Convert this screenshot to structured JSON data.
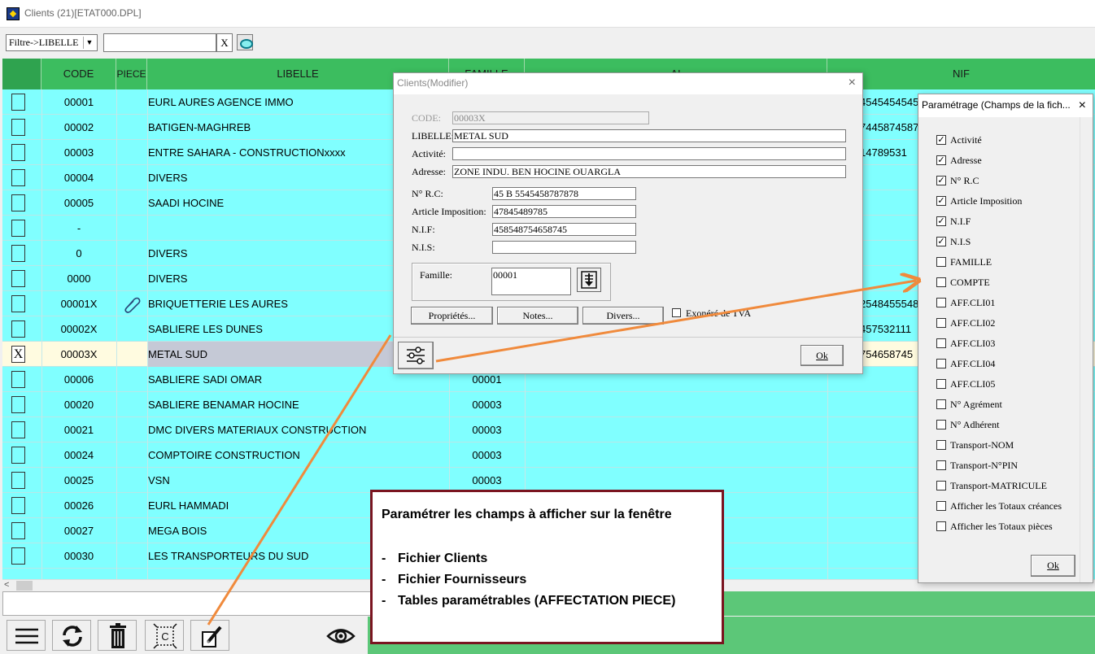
{
  "window": {
    "title": "Clients (21)[ETAT000.DPL]"
  },
  "filter": {
    "selected": "Filtre->LIBELLE",
    "value": "",
    "clear_label": "X"
  },
  "grid": {
    "columns": [
      "CODE",
      "PIECE",
      "LIBELLE",
      "FAMILLE",
      "AI",
      "NIF"
    ],
    "rows": [
      {
        "check": "",
        "code": "00001",
        "piece": "",
        "libelle": "EURL AURES AGENCE IMMO",
        "famille": "",
        "ai": "",
        "nif": "4545454545"
      },
      {
        "check": "",
        "code": "00002",
        "piece": "",
        "libelle": "BATIGEN-MAGHREB",
        "famille": "",
        "ai": "",
        "nif": "7445874587"
      },
      {
        "check": "",
        "code": "00003",
        "piece": "",
        "libelle": "ENTRE SAHARA - CONSTRUCTIONxxxx",
        "famille": "",
        "ai": "",
        "nif": "14789531"
      },
      {
        "check": "",
        "code": "00004",
        "piece": "",
        "libelle": "DIVERS",
        "famille": "",
        "ai": "",
        "nif": ""
      },
      {
        "check": "",
        "code": "00005",
        "piece": "",
        "libelle": "SAADI HOCINE",
        "famille": "",
        "ai": "",
        "nif": ""
      },
      {
        "check": "",
        "code": "-",
        "piece": "",
        "libelle": "",
        "famille": "",
        "ai": "",
        "nif": ""
      },
      {
        "check": "",
        "code": "0",
        "piece": "",
        "libelle": "DIVERS",
        "famille": "",
        "ai": "",
        "nif": ""
      },
      {
        "check": "",
        "code": "0000",
        "piece": "",
        "libelle": "DIVERS",
        "famille": "",
        "ai": "",
        "nif": ""
      },
      {
        "check": "",
        "code": "00001X",
        "piece": "paperclip",
        "libelle": "BRIQUETTERIE LES AURES",
        "famille": "",
        "ai": "",
        "nif": "2548455548"
      },
      {
        "check": "",
        "code": "00002X",
        "piece": "",
        "libelle": "SABLIERE LES DUNES",
        "famille": "",
        "ai": "",
        "nif": "457532111"
      },
      {
        "check": "X",
        "code": "00003X",
        "piece": "",
        "libelle": "METAL SUD",
        "famille": "",
        "ai": "",
        "nif": "754658745",
        "selected": true
      },
      {
        "check": "",
        "code": "00006",
        "piece": "",
        "libelle": "SABLIERE SADI  OMAR",
        "famille": "00001",
        "ai": "",
        "nif": ""
      },
      {
        "check": "",
        "code": "00020",
        "piece": "",
        "libelle": "SABLIERE BENAMAR HOCINE",
        "famille": "00003",
        "ai": "",
        "nif": ""
      },
      {
        "check": "",
        "code": "00021",
        "piece": "",
        "libelle": "DMC DIVERS MATERIAUX CONSTRUCTION",
        "famille": "00003",
        "ai": "",
        "nif": ""
      },
      {
        "check": "",
        "code": "00024",
        "piece": "",
        "libelle": "COMPTOIRE CONSTRUCTION",
        "famille": "00003",
        "ai": "",
        "nif": ""
      },
      {
        "check": "",
        "code": "00025",
        "piece": "",
        "libelle": "VSN",
        "famille": "00003",
        "ai": "",
        "nif": ""
      },
      {
        "check": "",
        "code": "00026",
        "piece": "",
        "libelle": "EURL  HAMMADI",
        "famille": "",
        "ai": "",
        "nif": ""
      },
      {
        "check": "",
        "code": "00027",
        "piece": "",
        "libelle": "MEGA BOIS",
        "famille": "",
        "ai": "",
        "nif": ""
      },
      {
        "check": "",
        "code": "00030",
        "piece": "",
        "libelle": "LES TRANSPORTEURS DU SUD",
        "famille": "",
        "ai": "",
        "nif": ""
      }
    ]
  },
  "toolbar": {
    "icons": [
      "menu-icon",
      "refresh-icon",
      "trash-icon",
      "select-all-icon",
      "edit-icon",
      "eye-icon"
    ]
  },
  "dialog": {
    "title": "Clients(Modifier)",
    "close": "×",
    "code_label": "CODE:",
    "code_value": "00003X",
    "libelle_label": "LIBELLE:",
    "libelle_value": "METAL SUD",
    "activite_label": "Activité:",
    "activite_value": "",
    "adresse_label": "Adresse:",
    "adresse_value": "ZONE INDU. BEN HOCINE OUARGLA",
    "rc_label": "N° R.C:",
    "rc_value": "45 B 5545458787878",
    "art_label": "Article Imposition:",
    "art_value": "47845489785",
    "nif_label": "N.I.F:",
    "nif_value": "458548754658745",
    "nis_label": "N.I.S:",
    "nis_value": "",
    "famille_label": "Famille:",
    "famille_value": "00001",
    "btn_proprietes": "Propriétés...",
    "btn_notes": "Notes...",
    "btn_divers": "Divers...",
    "exonere_label": "Exonéré de TVA",
    "ok": "Ok"
  },
  "param": {
    "title": "Paramétrage (Champs de la fich...",
    "close": "×",
    "items": [
      {
        "label": "Activité",
        "checked": true
      },
      {
        "label": "Adresse",
        "checked": true
      },
      {
        "label": "N° R.C",
        "checked": true
      },
      {
        "label": "Article Imposition",
        "checked": true
      },
      {
        "label": "N.I.F",
        "checked": true
      },
      {
        "label": "N.I.S",
        "checked": true
      },
      {
        "label": "FAMILLE",
        "checked": false
      },
      {
        "label": "COMPTE",
        "checked": false
      },
      {
        "label": "AFF.CLI01",
        "checked": false
      },
      {
        "label": "AFF.CLI02",
        "checked": false
      },
      {
        "label": "AFF.CLI03",
        "checked": false
      },
      {
        "label": "AFF.CLI04",
        "checked": false
      },
      {
        "label": "AFF.CLI05",
        "checked": false
      },
      {
        "label": "N° Agrément",
        "checked": false
      },
      {
        "label": "N° Adhérent",
        "checked": false
      },
      {
        "label": "Transport-NOM",
        "checked": false
      },
      {
        "label": "Transport-N°PIN",
        "checked": false
      },
      {
        "label": "Transport-MATRICULE",
        "checked": false
      },
      {
        "label": "Afficher les Totaux créances",
        "checked": false
      },
      {
        "label": "Afficher les Totaux pièces",
        "checked": false
      }
    ],
    "ok": "Ok"
  },
  "callout": {
    "title": "Paramétrer les champs à afficher sur la fenêtre",
    "items": [
      "Fichier Clients",
      "Fichier Fournisseurs",
      "Tables paramétrables (AFFECTATION PIECE)"
    ],
    "dash": "-"
  },
  "colors": {
    "grid_bg": "#80ffff",
    "header_bg": "#3cbd5f",
    "callout_border": "#7a1420",
    "arrow": "#f08a3c"
  }
}
